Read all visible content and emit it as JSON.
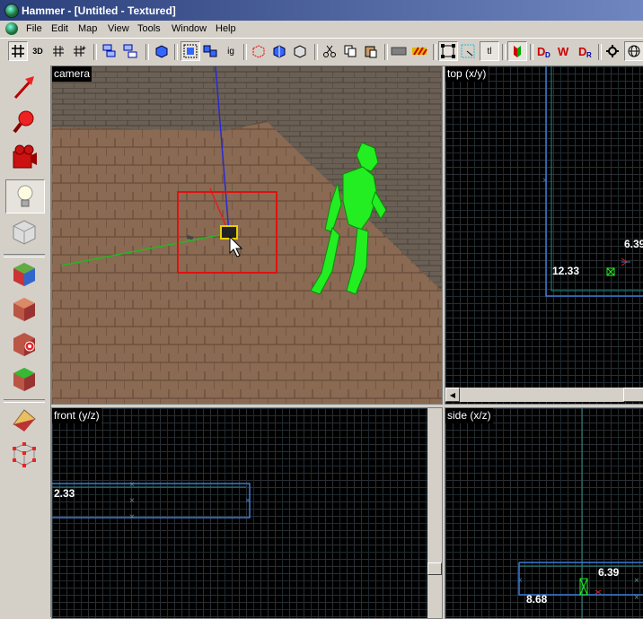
{
  "window": {
    "title": "Hammer - [Untitled - Textured]"
  },
  "menu": [
    "File",
    "Edit",
    "Map",
    "View",
    "Tools",
    "Window",
    "Help"
  ],
  "toolbar": {
    "three_d_label": "3D",
    "ig_label": "ig",
    "tl_label": "tl"
  },
  "left_tools": [
    "selection-tool",
    "magnify-tool",
    "camera-tool",
    "entity-tool",
    "block-tool",
    "texture-application-tool",
    "apply-current-texture-tool",
    "apply-decals-tool",
    "overlay-tool",
    "clipping-tool",
    "vertex-tool"
  ],
  "views": {
    "camera": {
      "label": "camera"
    },
    "top": {
      "label": "top (x/y)",
      "coords": [
        "6.39",
        "12.33"
      ]
    },
    "front": {
      "label": "front (y/z)",
      "coords": [
        "2.33"
      ]
    },
    "side": {
      "label": "side (x/z)",
      "coords": [
        "6.39",
        "8.68"
      ]
    }
  },
  "colors": {
    "selection": "#e01010",
    "grid_blue": "#3a7ad6",
    "grid_cyan": "#2a8a8a",
    "model_green": "#22ee22"
  }
}
